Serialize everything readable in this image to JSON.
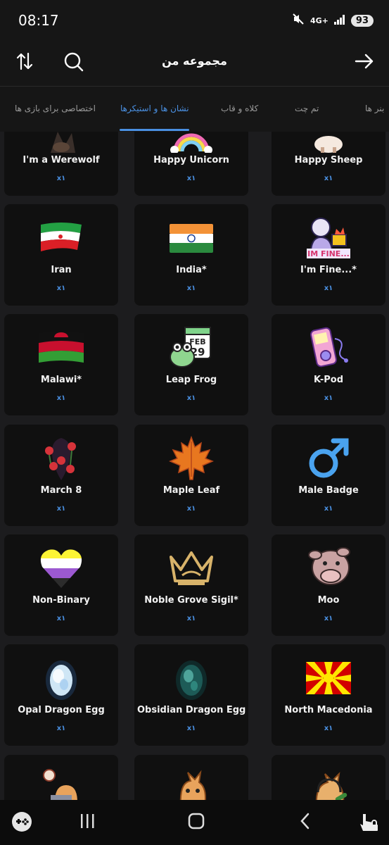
{
  "status": {
    "time": "08:17",
    "network": "4G+",
    "battery": "93"
  },
  "header": {
    "title": "مجموعه من"
  },
  "tabs": [
    {
      "label": "بنر ها"
    },
    {
      "label": "تم چت"
    },
    {
      "label": "کلاه و قاب"
    },
    {
      "label": "نشان ها و استیکرها"
    },
    {
      "label": "اختصاصی برای بازی ها"
    }
  ],
  "items": [
    {
      "name": "I'm a Werewolf",
      "qty": "x۱",
      "icon": "werewolf-sticker"
    },
    {
      "name": "Happy Unicorn",
      "qty": "x۱",
      "icon": "unicorn-sticker"
    },
    {
      "name": "Happy Sheep",
      "qty": "x۱",
      "icon": "sheep-sticker"
    },
    {
      "name": "Iran",
      "qty": "x۱",
      "icon": "iran-flag"
    },
    {
      "name": "India*",
      "qty": "x۱",
      "icon": "india-flag"
    },
    {
      "name": "I'm Fine...*",
      "qty": "x۱",
      "icon": "im-fine-sticker"
    },
    {
      "name": "Malawi*",
      "qty": "x۱",
      "icon": "malawi-flag"
    },
    {
      "name": "Leap Frog",
      "qty": "x۱",
      "icon": "leap-frog-sticker"
    },
    {
      "name": "K-Pod",
      "qty": "x۱",
      "icon": "kpod-sticker"
    },
    {
      "name": "March 8",
      "qty": "x۱",
      "icon": "march-8-sticker"
    },
    {
      "name": "Maple Leaf",
      "qty": "x۱",
      "icon": "maple-leaf"
    },
    {
      "name": "Male Badge",
      "qty": "x۱",
      "icon": "male-symbol"
    },
    {
      "name": "Non-Binary",
      "qty": "x۱",
      "icon": "non-binary-heart"
    },
    {
      "name": "Noble Grove Sigil*",
      "qty": "x۱",
      "icon": "crown-sigil"
    },
    {
      "name": "Moo",
      "qty": "x۱",
      "icon": "moo-sticker"
    },
    {
      "name": "Opal Dragon Egg",
      "qty": "x۱",
      "icon": "opal-egg"
    },
    {
      "name": "Obsidian Dragon Egg",
      "qty": "x۱",
      "icon": "obsidian-egg"
    },
    {
      "name": "North Macedonia",
      "qty": "x۱",
      "icon": "north-macedonia-flag"
    },
    {
      "name": "",
      "qty": "",
      "icon": "cat-laptop-sticker"
    },
    {
      "name": "",
      "qty": "",
      "icon": "cat-sticker"
    },
    {
      "name": "",
      "qty": "",
      "icon": "cat-headset-sticker"
    }
  ]
}
